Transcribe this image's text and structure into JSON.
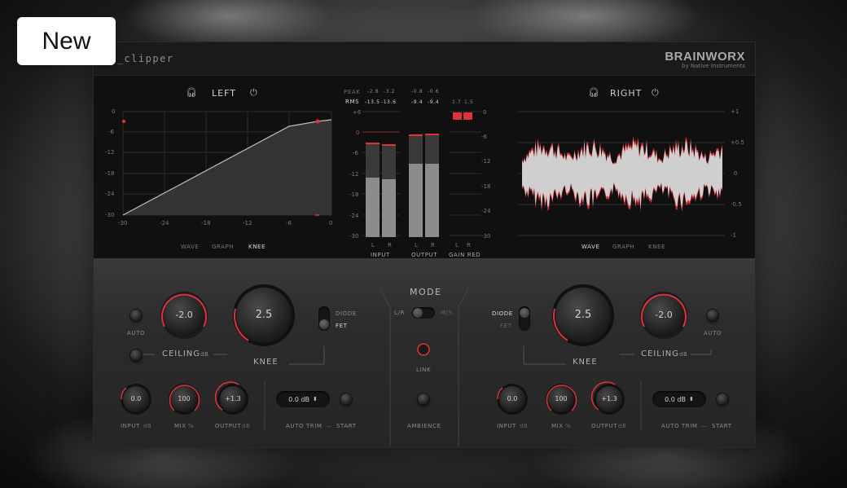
{
  "badge": {
    "label": "New"
  },
  "plugin": {
    "title": "k_clipper",
    "brand": {
      "name": "BRAINWORX",
      "sub": "by Native Instruments"
    },
    "left_panel": {
      "header": "LEFT",
      "y_ticks": [
        "0",
        "-6",
        "-12",
        "-18",
        "-24",
        "-30"
      ],
      "x_ticks": [
        "-30",
        "-24",
        "-18",
        "-12",
        "-6",
        "0"
      ],
      "views": [
        "WAVE",
        "GRAPH",
        "KNEE"
      ],
      "active_view": "KNEE"
    },
    "right_panel": {
      "header": "RIGHT",
      "y_ticks": [
        "+1",
        "+0.5",
        "0",
        "-0.5",
        "-1"
      ],
      "views": [
        "WAVE",
        "GRAPH",
        "KNEE"
      ],
      "active_view": "WAVE"
    },
    "meters": {
      "peak_label": "PEAK",
      "rms_label": "RMS",
      "input_peak": [
        "-2.8",
        "-3.2"
      ],
      "input_rms": [
        "-13.5",
        "-13.6"
      ],
      "output_peak": [
        "-0.8",
        "-0.6"
      ],
      "output_rms": [
        "-9.4",
        "-9.4"
      ],
      "gain_red": [
        "1.7",
        "1.5"
      ],
      "scale": [
        "+6",
        "0",
        "-6",
        "-12",
        "-18",
        "-24",
        "-30"
      ],
      "gr_scale": [
        "0",
        "-6",
        "-12",
        "-18",
        "-24",
        "-30"
      ],
      "channel_l": "L",
      "channel_r": "R",
      "input_label": "INPUT",
      "output_label": "OUTPUT",
      "gainred_label": "GAIN RED"
    },
    "left_controls": {
      "auto_label": "AUTO",
      "ceiling_value": "-2.0",
      "ceiling_label": "CEILING",
      "ceiling_unit": "dB",
      "knee_value": "2.5",
      "knee_label": "KNEE",
      "diode_label": "DIODE",
      "fet_label": "FET",
      "input_value": "0.0",
      "input_label": "INPUT",
      "input_unit": "dB",
      "mix_value": "100",
      "mix_label": "MIX",
      "mix_unit": "%",
      "output_value": "+1.3",
      "output_label": "OUTPUT",
      "output_unit": "dB",
      "trim_value": "0.0 dB",
      "auto_trim_label": "AUTO TRIM",
      "start_label": "START"
    },
    "center_controls": {
      "mode_label": "MODE",
      "lr_label": "L/R",
      "ms_label": "M/S",
      "link_label": "LINK",
      "ambience_label": "AMBIENCE"
    },
    "right_controls": {
      "auto_label": "AUTO",
      "ceiling_value": "-2.0",
      "ceiling_label": "CEILING",
      "ceiling_unit": "dB",
      "knee_value": "2.5",
      "knee_label": "KNEE",
      "diode_label": "DIODE",
      "fet_label": "FET",
      "input_value": "0.0",
      "input_label": "INPUT",
      "input_unit": "dB",
      "mix_value": "100",
      "mix_label": "MIX",
      "mix_unit": "%",
      "output_value": "+1.3",
      "output_label": "OUTPUT",
      "output_unit": "dB",
      "trim_value": "0.0 dB",
      "auto_trim_label": "AUTO TRIM",
      "start_label": "START"
    },
    "colors": {
      "accent": "#e0323a",
      "panel": "#1b1b1c",
      "display": "#101011"
    }
  }
}
